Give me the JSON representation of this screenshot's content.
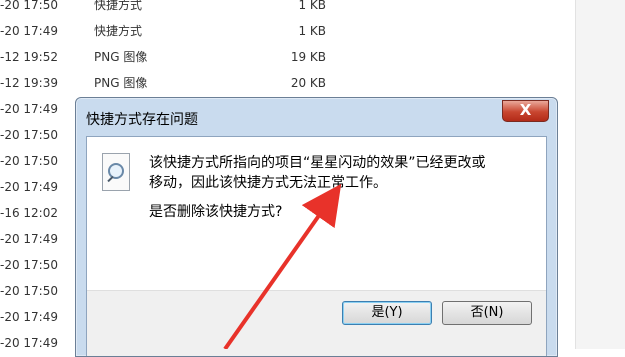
{
  "file_list": {
    "rows": [
      {
        "date": "-20 17:50",
        "type": "快捷方式",
        "size": "1 KB"
      },
      {
        "date": "-20 17:49",
        "type": "快捷方式",
        "size": "1 KB"
      },
      {
        "date": "-12 19:52",
        "type": "PNG 图像",
        "size": "19 KB"
      },
      {
        "date": "-12 19:39",
        "type": "PNG 图像",
        "size": "20 KB"
      },
      {
        "date": "-20 17:49",
        "type": "",
        "size": ""
      },
      {
        "date": "-20 17:50",
        "type": "",
        "size": ""
      },
      {
        "date": "-20 17:50",
        "type": "",
        "size": ""
      },
      {
        "date": "-20 17:49",
        "type": "",
        "size": ""
      },
      {
        "date": "-16 12:02",
        "type": "",
        "size": ""
      },
      {
        "date": "-20 17:49",
        "type": "",
        "size": ""
      },
      {
        "date": "-20 17:50",
        "type": "",
        "size": ""
      },
      {
        "date": "-20 17:50",
        "type": "",
        "size": ""
      },
      {
        "date": "-20 17:49",
        "type": "",
        "size": ""
      },
      {
        "date": "-20 17:49",
        "type": "",
        "size": ""
      }
    ]
  },
  "dialog": {
    "title": "快捷方式存在问题",
    "close_label": "X",
    "message": "该快捷方式所指向的项目“星星闪动的效果”已经更改或\n移动，因此该快捷方式无法正常工作。",
    "question": "是否删除该快捷方式?",
    "yes_label": "是(Y)",
    "no_label": "否(N)"
  },
  "annotation": {
    "arrow_color": "#e8322a"
  }
}
